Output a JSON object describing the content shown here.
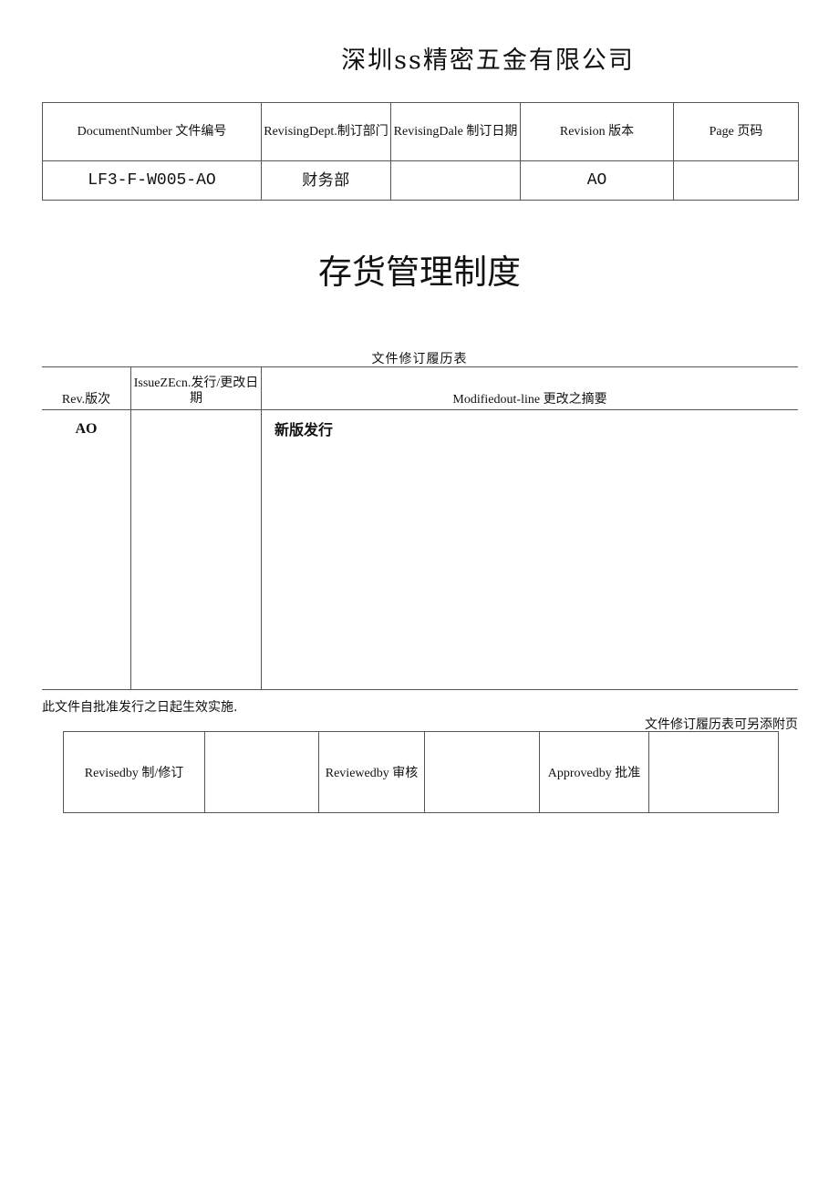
{
  "company_name": "深圳ss精密五金有限公司",
  "info_table": {
    "headers": [
      "DocumentNumber 文件编号",
      "RevisingDept.制订部门",
      "RevisingDale 制订日期",
      "Revision 版本",
      "Page 页码"
    ],
    "values": {
      "document_number": "LF3-F-W005-AO",
      "revising_dept": "财务部",
      "revising_date": "",
      "revision": "AO",
      "page": ""
    }
  },
  "document_title": "存货管理制度",
  "revision_history": {
    "caption": "文件修订履历表",
    "headers": {
      "rev": "Rev.版次",
      "issue_date": "IssueZEcn.发行/更改日期",
      "summary": "Modifiedout-line 更改之摘要"
    },
    "rows": [
      {
        "rev": "AO",
        "issue_date": "",
        "summary": "新版发行"
      }
    ]
  },
  "effective_note": "此文件自批准发行之日起生效实施.",
  "append_note": "文件修订履历表可另添附页",
  "signatures": {
    "revised_by_label": "Revisedby 制/修订",
    "revised_by_value": "",
    "reviewed_by_label": "Reviewedby 审核",
    "reviewed_by_value": "",
    "approved_by_label": "Approvedby 批准",
    "approved_by_value": ""
  }
}
